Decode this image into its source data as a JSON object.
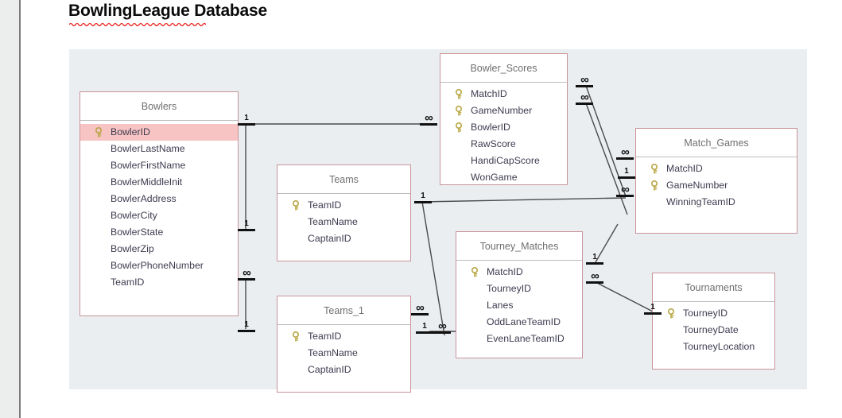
{
  "document": {
    "title": "BowlingLeague Database",
    "title_misspelled_word": "BowlingLeague"
  },
  "colors": {
    "canvas": "#eaeef1",
    "table_border": "#c9949a",
    "table_header_text": "#6f6f6f",
    "field_text": "#3c3c50",
    "primary_key_highlight": "#f7c3c3",
    "key_icon": "#b8a642",
    "relationship_line": "#4a4a4a",
    "spellcheck_underline": "#e8211c"
  },
  "diagram": {
    "type": "entity-relationship",
    "tables": [
      {
        "name": "Bowlers",
        "fields": [
          {
            "label": "BowlerID",
            "key": true,
            "selected": true
          },
          {
            "label": "BowlerLastName",
            "key": false,
            "selected": false
          },
          {
            "label": "BowlerFirstName",
            "key": false,
            "selected": false
          },
          {
            "label": "BowlerMiddleInit",
            "key": false,
            "selected": false
          },
          {
            "label": "BowlerAddress",
            "key": false,
            "selected": false
          },
          {
            "label": "BowlerCity",
            "key": false,
            "selected": false
          },
          {
            "label": "BowlerState",
            "key": false,
            "selected": false
          },
          {
            "label": "BowlerZip",
            "key": false,
            "selected": false
          },
          {
            "label": "BowlerPhoneNumber",
            "key": false,
            "selected": false
          },
          {
            "label": "TeamID",
            "key": false,
            "selected": false
          }
        ]
      },
      {
        "name": "Bowler_Scores",
        "fields": [
          {
            "label": "MatchID",
            "key": true,
            "selected": false
          },
          {
            "label": "GameNumber",
            "key": true,
            "selected": false
          },
          {
            "label": "BowlerID",
            "key": true,
            "selected": false
          },
          {
            "label": "RawScore",
            "key": false,
            "selected": false
          },
          {
            "label": "HandiCapScore",
            "key": false,
            "selected": false
          },
          {
            "label": "WonGame",
            "key": false,
            "selected": false
          }
        ]
      },
      {
        "name": "Match_Games",
        "fields": [
          {
            "label": "MatchID",
            "key": true,
            "selected": false
          },
          {
            "label": "GameNumber",
            "key": true,
            "selected": false
          },
          {
            "label": "WinningTeamID",
            "key": false,
            "selected": false
          }
        ]
      },
      {
        "name": "Teams",
        "fields": [
          {
            "label": "TeamID",
            "key": true,
            "selected": false
          },
          {
            "label": "TeamName",
            "key": false,
            "selected": false
          },
          {
            "label": "CaptainID",
            "key": false,
            "selected": false
          }
        ]
      },
      {
        "name": "Teams_1",
        "fields": [
          {
            "label": "TeamID",
            "key": true,
            "selected": false
          },
          {
            "label": "TeamName",
            "key": false,
            "selected": false
          },
          {
            "label": "CaptainID",
            "key": false,
            "selected": false
          }
        ]
      },
      {
        "name": "Tourney_Matches",
        "fields": [
          {
            "label": "MatchID",
            "key": true,
            "selected": false
          },
          {
            "label": "TourneyID",
            "key": false,
            "selected": false
          },
          {
            "label": "Lanes",
            "key": false,
            "selected": false
          },
          {
            "label": "OddLaneTeamID",
            "key": false,
            "selected": false
          },
          {
            "label": "EvenLaneTeamID",
            "key": false,
            "selected": false
          }
        ]
      },
      {
        "name": "Tournaments",
        "fields": [
          {
            "label": "TourneyID",
            "key": true,
            "selected": false
          },
          {
            "label": "TourneyDate",
            "key": false,
            "selected": false
          },
          {
            "label": "TourneyLocation",
            "key": false,
            "selected": false
          }
        ]
      }
    ],
    "cardinality_markers": [
      {
        "id": "m1",
        "symbol": "1",
        "near": "Bowlers.BowlerID-right"
      },
      {
        "id": "m2",
        "symbol": "∞",
        "near": "Bowler_Scores.BowlerID-left"
      },
      {
        "id": "m3",
        "symbol": "∞",
        "near": "Bowler_Scores.MatchID-right"
      },
      {
        "id": "m4",
        "symbol": "∞",
        "near": "Bowler_Scores.GameNumber-right"
      },
      {
        "id": "m5",
        "symbol": "∞",
        "near": "Match_Games.MatchID-left"
      },
      {
        "id": "m6",
        "symbol": "1",
        "near": "Match_Games.GameNumber-left"
      },
      {
        "id": "m7",
        "symbol": "∞",
        "near": "Match_Games.WinningTeamID-left"
      },
      {
        "id": "m8",
        "symbol": "1",
        "near": "Teams.TeamID-left"
      },
      {
        "id": "m9",
        "symbol": "1",
        "near": "Teams.TeamID-right"
      },
      {
        "id": "m10",
        "symbol": "∞",
        "near": "Bowlers.TeamID-right"
      },
      {
        "id": "m11",
        "symbol": "1",
        "near": "Teams_1.TeamID-left"
      },
      {
        "id": "m12",
        "symbol": "∞",
        "near": "Teams_1-right-upper"
      },
      {
        "id": "m13",
        "symbol": "1",
        "near": "Teams_1-right-lower"
      },
      {
        "id": "m14",
        "symbol": "∞",
        "near": "Tourney_Matches.EvenLaneTeamID-left"
      },
      {
        "id": "m15",
        "symbol": "1",
        "near": "Tourney_Matches.MatchID-right"
      },
      {
        "id": "m16",
        "symbol": "∞",
        "near": "Tourney_Matches.TourneyID-right"
      },
      {
        "id": "m17",
        "symbol": "1",
        "near": "Tournaments.TourneyID-left"
      }
    ]
  }
}
